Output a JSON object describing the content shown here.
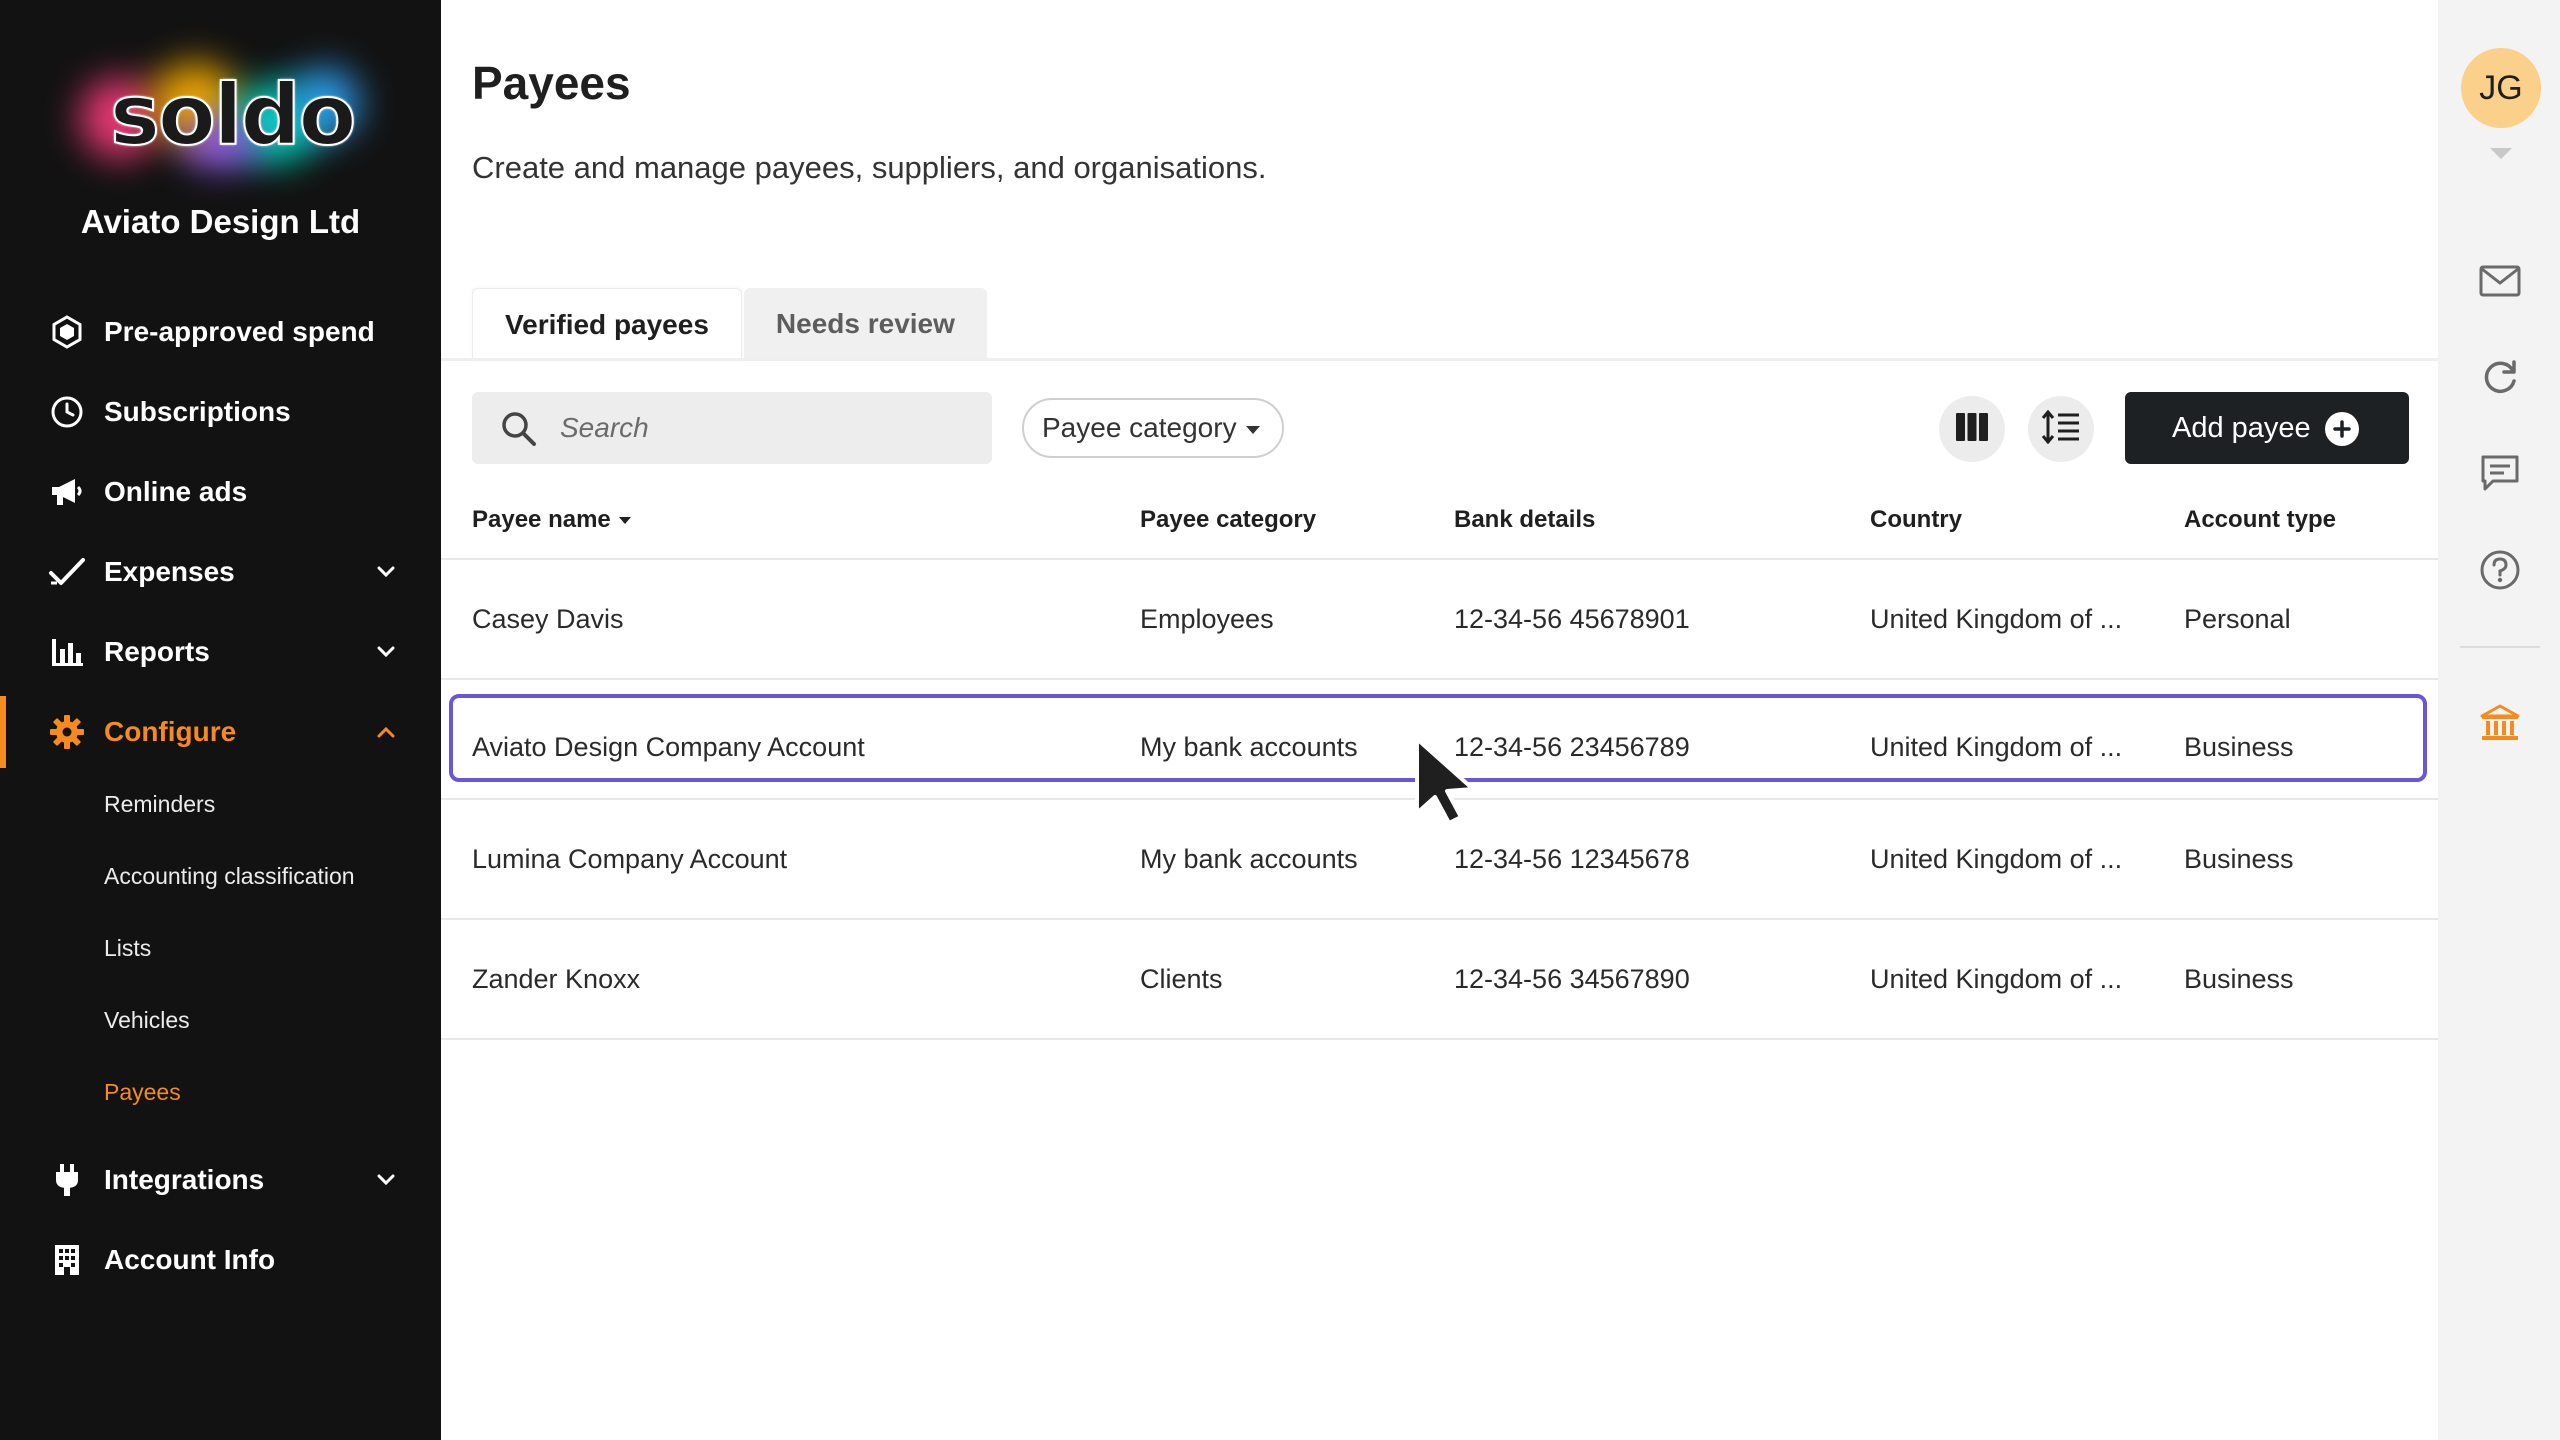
{
  "brand": {
    "logo_text": "soldo",
    "company": "Aviato Design Ltd"
  },
  "colors": {
    "accent": "#f58a1f",
    "sidebar_bg": "#121212",
    "primary_button": "#1e2124",
    "hover_outline": "#6b55d8",
    "avatar_bg": "#fbd08a"
  },
  "sidebar": {
    "items": [
      {
        "label": "Pre-approved spend",
        "icon": "hexagon-icon"
      },
      {
        "label": "Subscriptions",
        "icon": "clock-icon"
      },
      {
        "label": "Online ads",
        "icon": "megaphone-icon"
      },
      {
        "label": "Expenses",
        "icon": "check-icon",
        "expandable": true
      },
      {
        "label": "Reports",
        "icon": "bar-chart-icon",
        "expandable": true
      },
      {
        "label": "Configure",
        "icon": "gear-icon",
        "expandable": true,
        "active": true
      },
      {
        "label": "Integrations",
        "icon": "plug-icon",
        "expandable": true
      },
      {
        "label": "Account Info",
        "icon": "building-icon"
      }
    ],
    "configure_sub": [
      "Reminders",
      "Accounting classification",
      "Lists",
      "Vehicles",
      "Payees"
    ],
    "current_sub": "Payees"
  },
  "header": {
    "title": "Payees",
    "subtitle": "Create and manage payees, suppliers, and organisations."
  },
  "tabs": [
    {
      "label": "Verified payees",
      "active": true
    },
    {
      "label": "Needs review",
      "active": false
    }
  ],
  "toolbar": {
    "search_placeholder": "Search",
    "filter_label": "Payee category",
    "add_label": "Add payee"
  },
  "table": {
    "columns": [
      "Payee name",
      "Payee category",
      "Bank details",
      "Country",
      "Account type"
    ],
    "sorted_column": "Payee name",
    "rows": [
      {
        "name": "Casey Davis",
        "category": "Employees",
        "bank": "12-34-56 45678901",
        "country": "United Kingdom of ...",
        "type": "Personal"
      },
      {
        "name": "Aviato Design Company Account",
        "category": "My bank accounts",
        "bank": "12-34-56 23456789",
        "country": "United Kingdom of ...",
        "type": "Business"
      },
      {
        "name": "Lumina Company Account",
        "category": "My bank accounts",
        "bank": "12-34-56 12345678",
        "country": "United Kingdom of ...",
        "type": "Business"
      },
      {
        "name": "Zander Knoxx",
        "category": "Clients",
        "bank": "12-34-56 34567890",
        "country": "United Kingdom of ...",
        "type": "Business"
      }
    ],
    "hovered_row_index": 1
  },
  "rail": {
    "avatar_initials": "JG",
    "icons": [
      "mail-icon",
      "refresh-icon",
      "chat-icon",
      "help-icon",
      "bank-icon"
    ]
  }
}
